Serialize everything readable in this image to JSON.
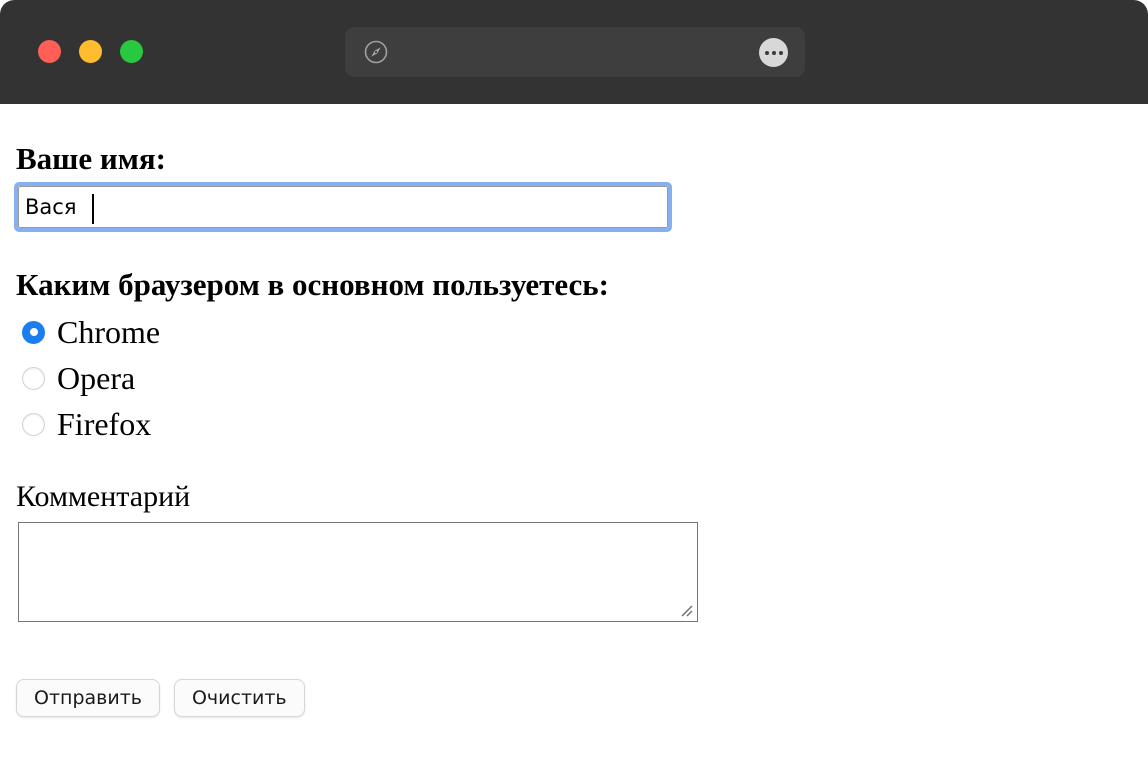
{
  "window": {
    "titlebar": {
      "traffic_lights": [
        {
          "name": "close",
          "color": "#ff5f56"
        },
        {
          "name": "minimize",
          "color": "#febc2e"
        },
        {
          "name": "maximize",
          "color": "#28c840"
        }
      ],
      "address_bar": {
        "url_text": "",
        "placeholder": "",
        "leading_icon": "safari-compass-icon",
        "trailing_icon": "more-ellipsis-icon"
      }
    }
  },
  "form": {
    "name_field": {
      "heading": "Ваше имя:",
      "value": "Вася",
      "placeholder": "",
      "focused": true
    },
    "browser_question": {
      "heading": "Каким браузером в основном пользуетесь:",
      "options": [
        {
          "label": "Chrome",
          "selected": true
        },
        {
          "label": "Opera",
          "selected": false
        },
        {
          "label": "Firefox",
          "selected": false
        }
      ]
    },
    "comment_field": {
      "label": "Комментарий",
      "value": "",
      "placeholder": ""
    },
    "buttons": [
      {
        "label": "Отправить",
        "name": "submit-button"
      },
      {
        "label": "Очистить",
        "name": "reset-button"
      }
    ]
  },
  "colors": {
    "titlebar_bg": "#333333",
    "address_bar_bg": "#3e3e3e",
    "focus_ring": "#86b0ef",
    "radio_selected": "#1a7ef0",
    "page_bg": "#ffffff"
  }
}
